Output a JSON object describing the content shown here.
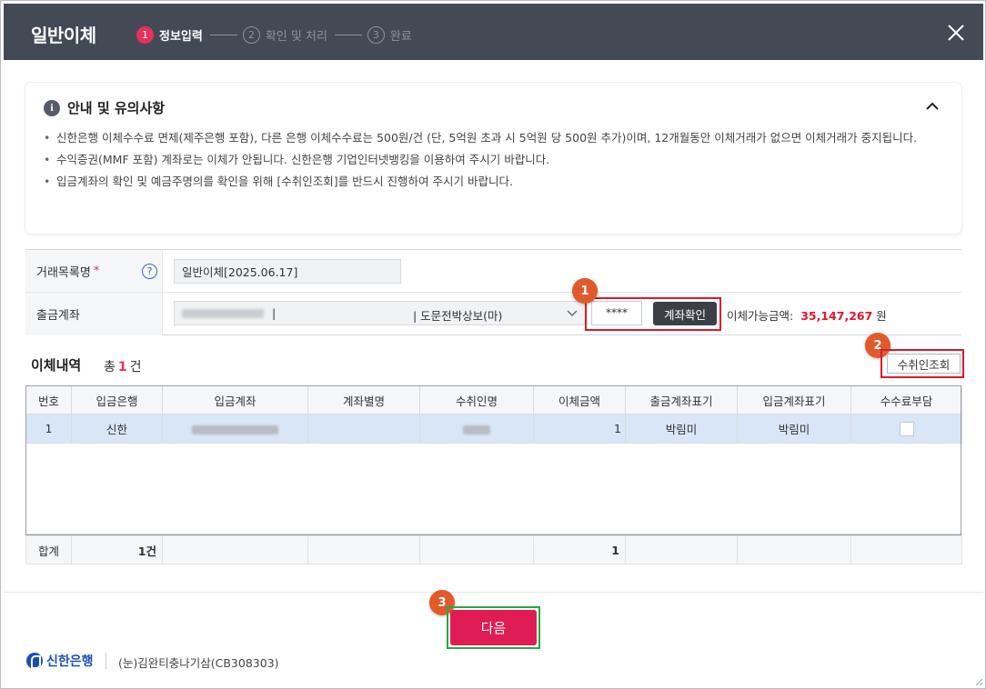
{
  "header": {
    "title": "일반이체",
    "steps": [
      {
        "num": "1",
        "label": "정보입력"
      },
      {
        "num": "2",
        "label": "확인 및 처리"
      },
      {
        "num": "3",
        "label": "완료"
      }
    ]
  },
  "notice": {
    "title": "안내 및 유의사항",
    "items": [
      "신한은행 이체수수료 면제(제주은행 포함), 다른 은행 이체수수료는 500원/건 (단, 5억원 초과 시 5억원 당 500원 추가)이며, 12개월동안 이체거래가 없으면 이체거래가 중지됩니다.",
      "수익증권(MMF 포함) 계좌로는 이체가 안됩니다. 신한은행 기업인터넷뱅킹을 이용하여 주시기 바랍니다.",
      "입금계좌의 확인 및 예금주명의를 확인을 위해 [수취인조회]를 반드시 진행하여 주시기 바랍니다."
    ]
  },
  "form": {
    "tx_label": "거래목록명",
    "required_mark": "*",
    "help": "?",
    "tx_value": "일반이체[2025.06.17]",
    "account_label": "출금계좌",
    "account_sep": "|",
    "account_owner": "| 도문전박상보(마)",
    "password_mask": "****",
    "check_button": "계좌확인",
    "available_label": "이체가능금액:",
    "available_amount": "35,147,267",
    "available_unit": "원"
  },
  "annotations": {
    "b1": "1",
    "b2": "2",
    "b3": "3"
  },
  "transfer": {
    "title": "이체내역",
    "count_prefix": "총",
    "count": "1",
    "count_suffix": "건",
    "payee_button": "수취인조회",
    "columns": [
      "번호",
      "입금은행",
      "입금계좌",
      "계좌별명",
      "수취인명",
      "이체금액",
      "출금계좌표기",
      "입금계좌표기",
      "수수료부담"
    ],
    "rows": [
      {
        "no": "1",
        "bank": "신한",
        "account": "",
        "alias": "",
        "payee": "",
        "amount": "1",
        "out_memo": "박림미",
        "in_memo": "박림미",
        "fee": false
      }
    ],
    "total": {
      "label": "합계",
      "count": "1건",
      "amount": "1"
    }
  },
  "footer": {
    "next_button": "다음",
    "bank_name": "신한은행",
    "company": "(눈)김완티충나기삼(CB308303)"
  },
  "colors": {
    "header_bg": "#434a56",
    "accent_red": "#e0162b",
    "primary": "#e01c55",
    "badge": "#e05a2b",
    "green_box": "#27a844"
  }
}
